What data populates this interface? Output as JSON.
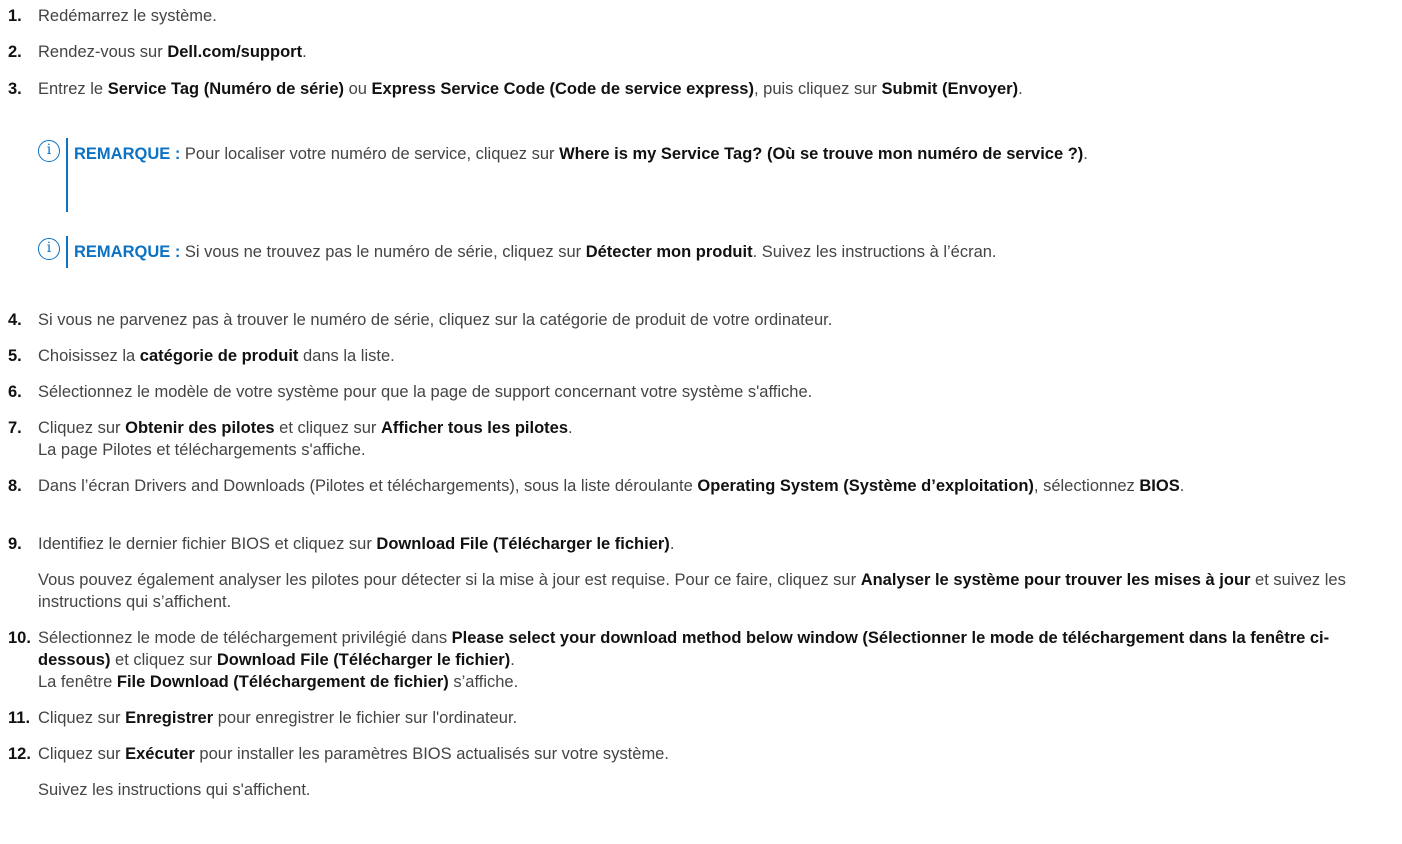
{
  "steps": [
    {
      "n": "1.",
      "t0": "Redémarrez le système."
    },
    {
      "n": "2.",
      "t0": "Rendez-vous sur ",
      "b0": "Dell.com/support",
      "t1": "."
    },
    {
      "n": "3.",
      "t0": "Entrez le ",
      "b0": "Service Tag (Numéro de série)",
      "t1": " ou ",
      "b1": "Express Service Code (Code de service express)",
      "t2": ", puis cliquez sur ",
      "b2": "Submit (Envoyer)",
      "t3": "."
    },
    {
      "n": "4.",
      "t0": "Si vous ne parvenez pas à trouver le numéro de série, cliquez sur la catégorie de produit de votre ordinateur."
    },
    {
      "n": "5.",
      "t0": "Choisissez la ",
      "b0": "catégorie de produit",
      "t1": " dans la liste."
    },
    {
      "n": "6.",
      "t0": "Sélectionnez le modèle de votre système pour que la page de support concernant votre système s'affiche."
    },
    {
      "n": "7.",
      "t0": "Cliquez sur ",
      "b0": "Obtenir des pilotes",
      "t1": " et cliquez sur ",
      "b1": "Afficher tous les pilotes",
      "t2": ".",
      "sub": "La page Pilotes et téléchargements s'affiche."
    },
    {
      "n": "8.",
      "t0": "Dans l’écran Drivers and Downloads (Pilotes et téléchargements), sous la liste déroulante ",
      "b0": "Operating System (Système d’exploitation)",
      "t1": ", sélectionnez ",
      "b1": "BIOS",
      "t2": "."
    },
    {
      "n": "9.",
      "t0": "Identifiez le dernier fichier BIOS et cliquez sur ",
      "b0": "Download File (Télécharger le fichier)",
      "t1": "."
    },
    {
      "n": "10.",
      "t0": "Sélectionnez le mode de téléchargement privilégié dans ",
      "b0": "Please select your download method below window (Sélectionner le mode de téléchargement dans la fenêtre ci-dessous)",
      "t1": " et cliquez sur ",
      "b1": "Download File (Télécharger le fichier)",
      "t2": ".",
      "s0": "La fenêtre ",
      "sb0": "File Download (Téléchargement de fichier)",
      "s1": " s’affiche."
    },
    {
      "n": "11.",
      "t0": "Cliquez sur ",
      "b0": "Enregistrer",
      "t1": " pour enregistrer le fichier sur l'ordinateur."
    },
    {
      "n": "12.",
      "t0": "Cliquez sur ",
      "b0": "Exécuter",
      "t1": " pour installer les paramètres BIOS actualisés sur votre système."
    }
  ],
  "notes": [
    {
      "label": "REMARQUE :",
      "t0": " Pour localiser votre numéro de service, cliquez sur ",
      "b0": "Where is my Service Tag? (Où se trouve mon numéro de service ?)",
      "t1": "."
    },
    {
      "label": "REMARQUE :",
      "t0": " Si vous ne trouvez pas le numéro de série, cliquez sur ",
      "b0": "Détecter mon produit",
      "t1": ". Suivez les instructions à l’écran."
    }
  ],
  "step9_para": {
    "t0": "Vous pouvez également analyser les pilotes pour détecter si la mise à jour est requise. Pour ce faire, cliquez sur ",
    "b0": "Analyser le système pour trouver les mises à jour",
    "t1": " et suivez les instructions qui s’affichent."
  },
  "step12_para": "Suivez les instructions qui s'affichent.",
  "note_icon": "info-icon",
  "accent_color": "#0b72c4"
}
